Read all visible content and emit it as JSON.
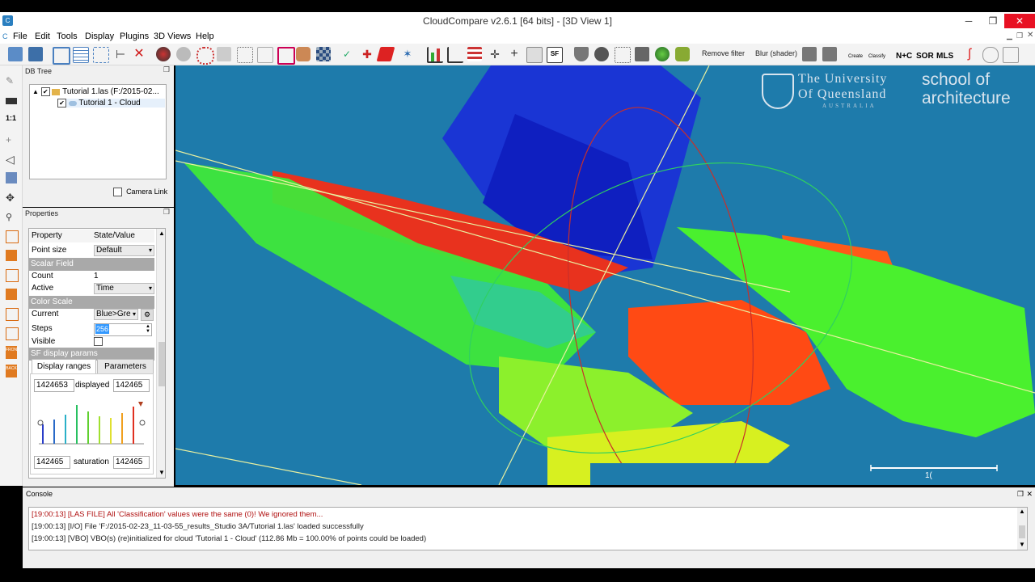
{
  "window": {
    "title": "CloudCompare v2.6.1 [64 bits] - [3D View 1]",
    "minimize": "─",
    "maximize": "❐",
    "close": "✕"
  },
  "menu": [
    "File",
    "Edit",
    "Tools",
    "Display",
    "Plugins",
    "3D Views",
    "Help"
  ],
  "toolbar": {
    "remove_filter": "Remove filter",
    "blur": "Blur (shader)",
    "canupo_create": "Create",
    "canupo_classify": "Classify",
    "nc": "N+C",
    "sor": "SOR",
    "mls": "MLS",
    "sf": "SF"
  },
  "left_toolbar": {
    "ratio": "1:1",
    "front": "FRONT",
    "back": "BACK"
  },
  "db_tree": {
    "title": "DB Tree",
    "items": [
      {
        "label": "Tutorial 1.las (F:/2015-02...",
        "checked": true
      },
      {
        "label": "Tutorial 1 - Cloud",
        "checked": true
      }
    ],
    "camera_link": "Camera Link"
  },
  "properties": {
    "title": "Properties",
    "col_property": "Property",
    "col_value": "State/Value",
    "point_size_label": "Point size",
    "point_size_value": "Default",
    "scalar_field_section": "Scalar Field",
    "count_label": "Count",
    "count_value": "1",
    "active_label": "Active",
    "active_value": "Time",
    "color_scale_section": "Color Scale",
    "current_label": "Current",
    "current_value": "Blue>Gre",
    "steps_label": "Steps",
    "steps_value": "256",
    "visible_label": "Visible",
    "sf_display_section": "SF display params",
    "tab_display": "Display ranges",
    "tab_params": "Parameters",
    "displayed_min": "1424653",
    "displayed_label": "displayed",
    "displayed_max": "142465",
    "saturation_min": "142465",
    "saturation_label": "saturation",
    "saturation_max": "142465"
  },
  "viewport": {
    "logo_line1": "The University",
    "logo_line2": "Of Queensland",
    "logo_line3": "AUSTRALIA",
    "school_line1": "school of",
    "school_line2": "architecture",
    "scale_label": "1("
  },
  "console": {
    "title": "Console",
    "lines": [
      {
        "text": "[19:00:13] [LAS FILE] All 'Classification' values were the same (0)! We ignored them...",
        "color": "#b01010"
      },
      {
        "text": "[19:00:13] [I/O] File 'F:/2015-02-23_11-03-55_results_Studio 3A/Tutorial 1.las' loaded successfully",
        "color": "#222222"
      },
      {
        "text": "[19:00:13] [VBO] VBO(s) (re)initialized for cloud 'Tutorial 1 - Cloud' (112.86 Mb = 100.00% of points could be loaded)",
        "color": "#222222"
      }
    ]
  },
  "colors": {
    "viewport_bg": "#1e7bab",
    "section_bg": "#a9a9a9",
    "selection": "#3399ff"
  }
}
